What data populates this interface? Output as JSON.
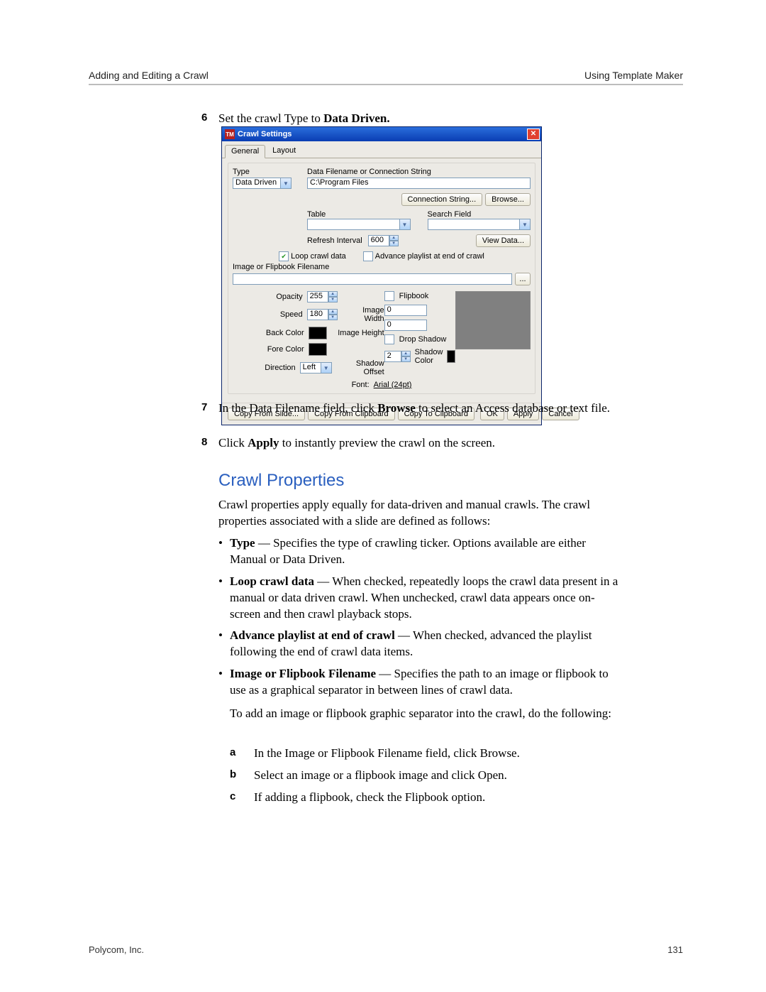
{
  "header": {
    "left": "Adding and Editing a Crawl",
    "right": "Using Template Maker"
  },
  "steps": {
    "six": {
      "num": "6",
      "text_pre": "Set the crawl Type to ",
      "text_bold": "Data Driven."
    },
    "seven": {
      "num": "7",
      "text_a": "In the Data Filename field, click ",
      "text_bold": "Browse",
      "text_b": " to select an Access database or text file."
    },
    "eight": {
      "num": "8",
      "text_a": "Click ",
      "text_bold": "Apply",
      "text_b": " to instantly preview the crawl on the screen."
    }
  },
  "dialog": {
    "title": "Crawl Settings",
    "tabs": {
      "general": "General",
      "layout": "Layout"
    },
    "type_label": "Type",
    "type_value": "Data Driven",
    "data_filename_label": "Data Filename or Connection String",
    "data_filename_value": "C:\\Program Files",
    "connection_string_btn": "Connection String...",
    "browse_btn": "Browse...",
    "table_label": "Table",
    "search_field_label": "Search Field",
    "refresh_label": "Refresh Interval",
    "refresh_value": "600",
    "view_data_btn": "View Data...",
    "loop_label": "Loop crawl data",
    "advance_label": "Advance playlist at end of crawl",
    "img_flip_label": "Image or Flipbook Filename",
    "ellipsis_btn": "...",
    "opacity_label": "Opacity",
    "opacity_value": "255",
    "speed_label": "Speed",
    "speed_value": "180",
    "backcolor_label": "Back Color",
    "forecolor_label": "Fore Color",
    "direction_label": "Direction",
    "direction_value": "Left",
    "flipbook_label": "Flipbook",
    "image_width_label": "Image Width",
    "image_width_value": "0",
    "image_height_label": "Image Height",
    "image_height_value": "0",
    "drop_shadow_label": "Drop Shadow",
    "shadow_offset_label": "Shadow Offset",
    "shadow_offset_value": "2",
    "shadow_color_label": "Shadow Color",
    "font_label": "Font:",
    "font_value": "Arial (24pt)",
    "copy_from_slide": "Copy From Slide...",
    "copy_from_clipboard": "Copy From Clipboard",
    "copy_to_clipboard": "Copy To Clipboard",
    "ok": "OK",
    "apply": "Apply",
    "cancel": "Cancel"
  },
  "section": {
    "title": "Crawl Properties",
    "intro": "Crawl properties apply equally for data-driven and manual crawls. The crawl properties associated with a slide are defined as follows:",
    "bullets": {
      "type": {
        "bold": "Type",
        "text": " — Specifies the type of crawling ticker. Options available are either Manual or Data Driven."
      },
      "loop": {
        "bold": "Loop crawl data",
        "text": " — When checked, repeatedly loops the crawl data present in a manual or data driven crawl. When unchecked, crawl data appears once on-screen and then crawl playback stops."
      },
      "advance": {
        "bold": "Advance playlist at end of crawl",
        "text": " — When checked, advanced the playlist following the end of crawl data items."
      },
      "image": {
        "bold": "Image or Flipbook Filename",
        "text": " — Specifies the path to an image or flipbook to use as a graphical separator in between lines of crawl data."
      },
      "image_sub": "To add an image or flipbook graphic separator into the crawl, do the following:"
    },
    "substeps": {
      "a": {
        "num": "a",
        "text": "In the Image or Flipbook Filename field, click Browse."
      },
      "b": {
        "num": "b",
        "text": "Select an image or a flipbook image and click Open."
      },
      "c": {
        "num": "c",
        "text": "If adding a flipbook, check the Flipbook option."
      }
    }
  },
  "footer": {
    "left": "Polycom, Inc.",
    "right": "131"
  }
}
